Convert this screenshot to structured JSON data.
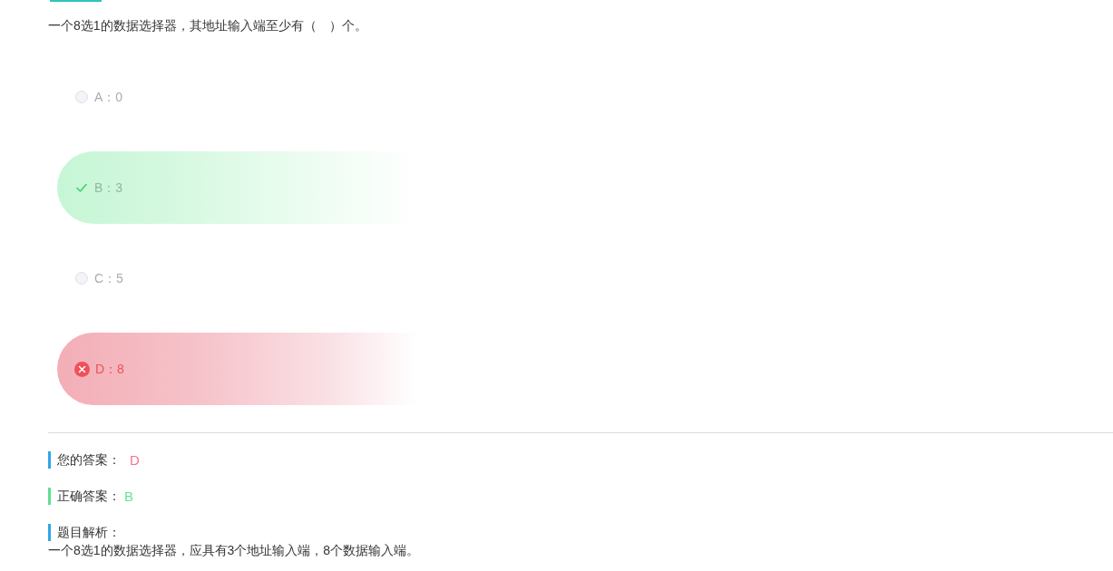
{
  "question": {
    "text": "一个8选1的数据选择器，其地址输入端至少有（　）个。"
  },
  "options": [
    {
      "text": "A：0",
      "selected": false,
      "correct": false
    },
    {
      "text": "B：3",
      "selected": false,
      "correct": true
    },
    {
      "text": "C：5",
      "selected": false,
      "correct": false
    },
    {
      "text": "D：8",
      "selected": true,
      "correct": false
    }
  ],
  "your_answer": {
    "label": "您的答案：",
    "value": "D"
  },
  "correct_answer": {
    "label": "正确答案：",
    "value": "B"
  },
  "analysis": {
    "label": "题目解析：",
    "text": "一个8选1的数据选择器，应具有3个地址输入端，8个数据输入端。"
  }
}
